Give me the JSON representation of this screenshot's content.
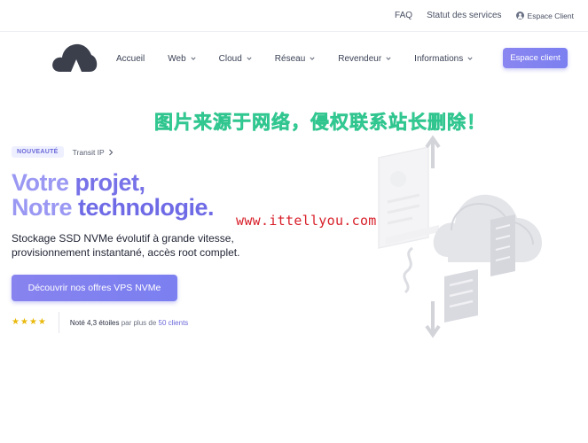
{
  "topbar": {
    "faq": "FAQ",
    "status": "Statut des services",
    "client": "Espace Client"
  },
  "nav": {
    "items": [
      {
        "label": "Accueil",
        "dropdown": false
      },
      {
        "label": "Web",
        "dropdown": true
      },
      {
        "label": "Cloud",
        "dropdown": true
      },
      {
        "label": "Réseau",
        "dropdown": true
      },
      {
        "label": "Revendeur",
        "dropdown": true
      },
      {
        "label": "Informations",
        "dropdown": true
      }
    ],
    "client_button": "Espace client"
  },
  "watermark": {
    "cn": "图片来源于网络，侵权联系站长删除！",
    "url": "www.ittellyou.com"
  },
  "hero": {
    "badge": "NOUVEAUTÉ",
    "badge_link": "Transit IP",
    "title_line1_a": "Votre ",
    "title_line1_b": "projet,",
    "title_line2_a": "Notre ",
    "title_line2_b": "technologie.",
    "subtitle": "Stockage SSD NVMe évolutif à grande vitesse, provisionnement instantané, accès root complet.",
    "cta": "Découvrir nos offres VPS NVMe"
  },
  "rating": {
    "stars": 4,
    "max_stars": 5,
    "prefix": "Noté ",
    "score": "4,3 étoiles",
    "middle": " par plus de ",
    "clients": "50 clients"
  },
  "colors": {
    "accent": "#7b7ff0",
    "accent_light": "#9a98f3",
    "star": "#e9b90c",
    "watermark_green": "#40e0a8",
    "watermark_red": "#d8202a"
  }
}
